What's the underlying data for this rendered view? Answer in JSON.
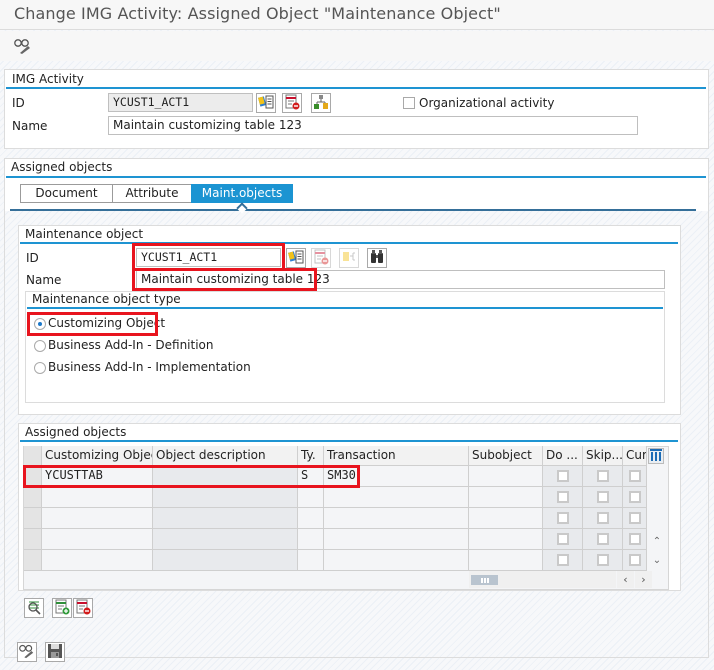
{
  "window": {
    "title": "Change IMG Activity: Assigned Object \"Maintenance Object\""
  },
  "toolbar": {
    "display_change_icon": "glasses-pencil-icon"
  },
  "img_activity": {
    "section_title": "IMG Activity",
    "id_label": "ID",
    "id_value": "YCUST1_ACT1",
    "name_label": "Name",
    "name_value": "Maintain customizing table 123",
    "org_activity_label": "Organizational activity",
    "org_activity_checked": false,
    "icons": [
      "documentation-icon",
      "delete-entry-icon",
      "hierarchy-icon"
    ]
  },
  "assigned_objects_section": {
    "title": "Assigned objects",
    "tabs": [
      {
        "label": "Document",
        "active": false
      },
      {
        "label": "Attribute",
        "active": false
      },
      {
        "label": "Maint.objects",
        "active": true
      }
    ]
  },
  "maintenance_object": {
    "section_title": "Maintenance object",
    "id_label": "ID",
    "id_value": "YCUST1_ACT1",
    "name_label": "Name",
    "name_value": "Maintain customizing table 123",
    "icons": [
      "documentation-icon",
      "delete-entry-icon",
      "hierarchy-icon",
      "binoculars-icon"
    ],
    "type_section_title": "Maintenance object type",
    "types": [
      {
        "label": "Customizing Object",
        "selected": true
      },
      {
        "label": "Business Add-In - Definition",
        "selected": false
      },
      {
        "label": "Business Add-In - Implementation",
        "selected": false
      }
    ]
  },
  "assigned_objects_table": {
    "title": "Assigned objects",
    "columns": [
      "Customizing Object",
      "Object description",
      "Ty.",
      "Transaction",
      "Subobject",
      "Do ...",
      "Skip...",
      "Curr"
    ],
    "rows": [
      {
        "customizing_object": "YCUSTTAB",
        "object_description": "",
        "type": "S",
        "transaction": "SM30",
        "subobject": "",
        "do": false,
        "skip": false,
        "curr": false
      },
      {
        "customizing_object": "",
        "object_description": "",
        "type": "",
        "transaction": "",
        "subobject": "",
        "do": false,
        "skip": false,
        "curr": false
      },
      {
        "customizing_object": "",
        "object_description": "",
        "type": "",
        "transaction": "",
        "subobject": "",
        "do": false,
        "skip": false,
        "curr": false
      },
      {
        "customizing_object": "",
        "object_description": "",
        "type": "",
        "transaction": "",
        "subobject": "",
        "do": false,
        "skip": false,
        "curr": false
      },
      {
        "customizing_object": "",
        "object_description": "",
        "type": "",
        "transaction": "",
        "subobject": "",
        "do": false,
        "skip": false,
        "curr": false
      }
    ],
    "table_buttons": [
      "details-icon",
      "insert-row-icon",
      "delete-row-icon"
    ]
  },
  "footer": {
    "buttons": [
      "display-change-icon",
      "save-icon"
    ]
  },
  "colors": {
    "accent": "#1e94d2",
    "highlight": "#e8141e"
  }
}
